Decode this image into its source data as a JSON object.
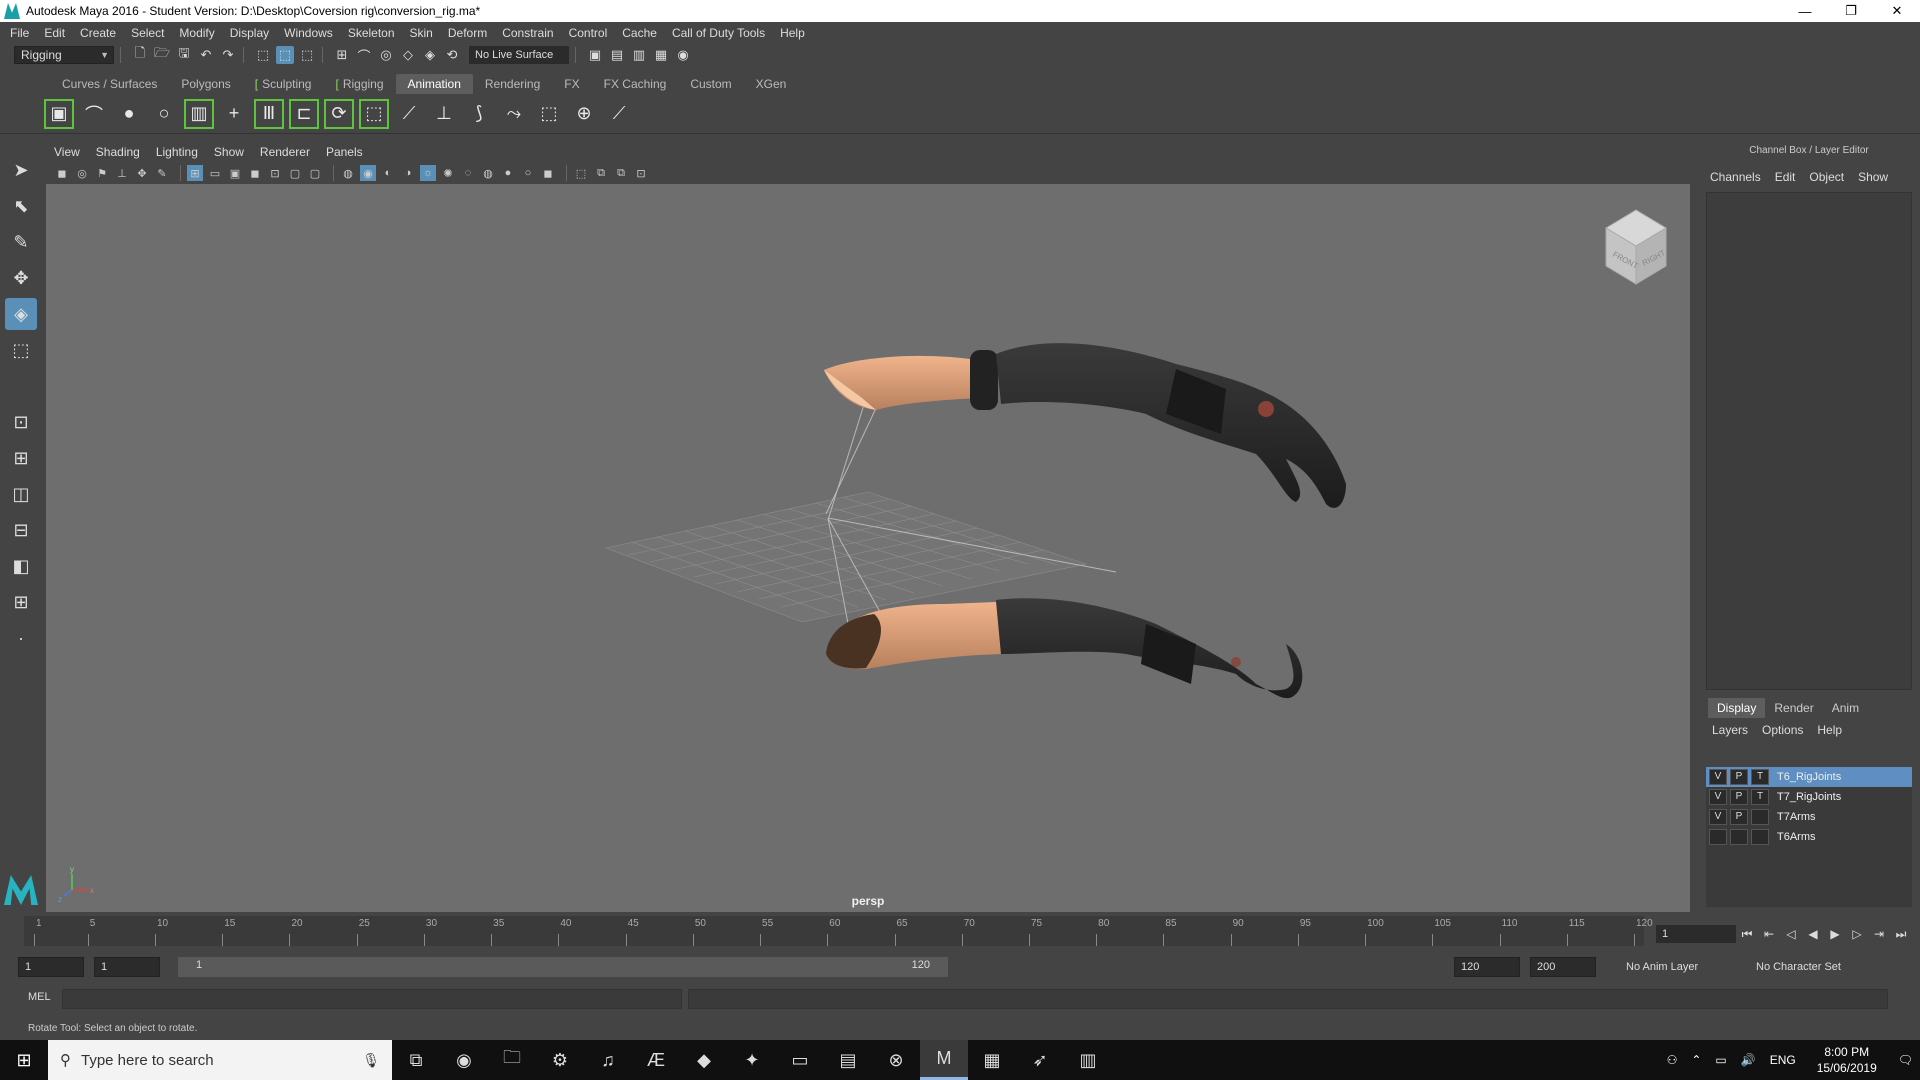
{
  "window": {
    "title": "Autodesk Maya 2016 - Student Version: D:\\Desktop\\Coversion rig\\conversion_rig.ma*",
    "minimize": "—",
    "maximize": "❐",
    "close": "✕"
  },
  "menubar": [
    "File",
    "Edit",
    "Create",
    "Select",
    "Modify",
    "Display",
    "Windows",
    "Skeleton",
    "Skin",
    "Deform",
    "Constrain",
    "Control",
    "Cache",
    "Call of Duty Tools",
    "Help"
  ],
  "status_line": {
    "mode": "Rigging",
    "live_surface": "No Live Surface"
  },
  "shelf": {
    "tabs": [
      "Curves / Surfaces",
      "Polygons",
      "Sculpting",
      "Rigging",
      "Animation",
      "Rendering",
      "FX",
      "FX Caching",
      "Custom",
      "XGen"
    ],
    "active_tab": "Animation"
  },
  "viewport": {
    "menu": [
      "View",
      "Shading",
      "Lighting",
      "Show",
      "Renderer",
      "Panels"
    ],
    "camera": "persp",
    "viewcube": {
      "front": "FRONT",
      "right": "RIGHT"
    },
    "axis": {
      "x": "x",
      "y": "y",
      "z": "z"
    }
  },
  "channel_box": {
    "title": "Channel Box / Layer Editor",
    "menu": [
      "Channels",
      "Edit",
      "Object",
      "Show"
    ]
  },
  "layer_editor": {
    "tabs": [
      "Display",
      "Render",
      "Anim"
    ],
    "active_tab": "Display",
    "menu": [
      "Layers",
      "Options",
      "Help"
    ],
    "layers": [
      {
        "v": "V",
        "p": "P",
        "t": "T",
        "name": "T6_RigJoints",
        "selected": true
      },
      {
        "v": "V",
        "p": "P",
        "t": "T",
        "name": "T7_RigJoints",
        "selected": false
      },
      {
        "v": "V",
        "p": "P",
        "t": "",
        "name": "T7Arms",
        "selected": false
      },
      {
        "v": "",
        "p": "",
        "t": "",
        "name": "T6Arms",
        "selected": false
      }
    ]
  },
  "time_slider": {
    "ticks": [
      "1",
      "5",
      "10",
      "15",
      "20",
      "25",
      "30",
      "35",
      "40",
      "45",
      "50",
      "55",
      "60",
      "65",
      "70",
      "75",
      "80",
      "85",
      "90",
      "95",
      "100",
      "105",
      "110",
      "115",
      "120"
    ],
    "current_frame": "1"
  },
  "range_slider": {
    "start": "1",
    "playback_start": "1",
    "range_start_label": "1",
    "range_end_label": "120",
    "playback_end": "120",
    "end": "200",
    "anim_layer": "No Anim Layer",
    "character_set": "No Character Set"
  },
  "command_line": {
    "label": "MEL"
  },
  "help_line": "Rotate Tool: Select an object to rotate.",
  "taskbar": {
    "search_placeholder": "Type here to search",
    "language": "ENG",
    "time": "8:00 PM",
    "date": "15/06/2019"
  },
  "colors": {
    "ui_bg": "#444444",
    "viewport_bg": "#6e6e6e",
    "selection": "#5e8ec2",
    "shelf_highlight": "#5ec43e",
    "maya_teal": "#27b3bf"
  }
}
